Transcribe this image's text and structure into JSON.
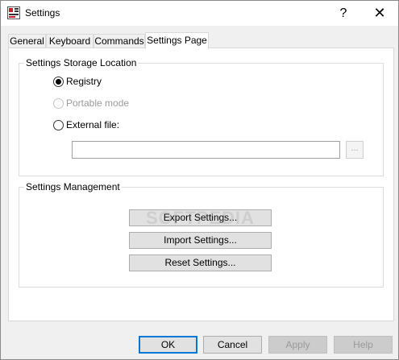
{
  "window": {
    "title": "Settings",
    "help_glyph": "?",
    "close_glyph": "✕"
  },
  "tabs": [
    {
      "label": "General",
      "active": false
    },
    {
      "label": "Keyboard",
      "active": false
    },
    {
      "label": "Commands",
      "active": false
    },
    {
      "label": "Settings Page",
      "active": true
    }
  ],
  "storage_group": {
    "title": "Settings Storage Location",
    "options": [
      {
        "label": "Registry",
        "checked": true,
        "enabled": true
      },
      {
        "label": "Portable mode",
        "checked": false,
        "enabled": false
      },
      {
        "label": "External file:",
        "checked": false,
        "enabled": true
      }
    ],
    "file_path_value": "",
    "browse_label": "..."
  },
  "management_group": {
    "title": "Settings Management",
    "export_label": "Export Settings...",
    "import_label": "Import Settings...",
    "reset_label": "Reset Settings..."
  },
  "watermark": "SOFTPEDIA",
  "footer": {
    "ok_label": "OK",
    "cancel_label": "Cancel",
    "apply_label": "Apply",
    "help_label": "Help"
  },
  "colors": {
    "focus_border": "#0078d7",
    "dialog_bg": "#f0f0f0",
    "panel_bg": "#ffffff"
  },
  "icons": {
    "app": "settings-app-icon",
    "help": "help-icon",
    "close": "close-icon"
  }
}
